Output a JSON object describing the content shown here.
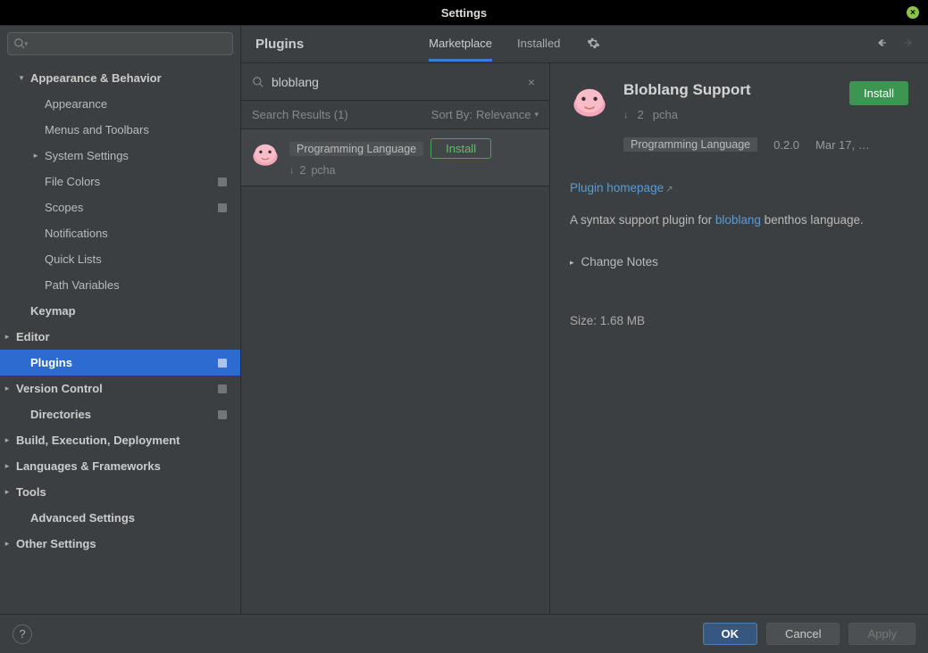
{
  "window": {
    "title": "Settings"
  },
  "sidebar": {
    "search_placeholder": "",
    "items": [
      {
        "label": "Appearance & Behavior"
      },
      {
        "label": "Appearance"
      },
      {
        "label": "Menus and Toolbars"
      },
      {
        "label": "System Settings"
      },
      {
        "label": "File Colors"
      },
      {
        "label": "Scopes"
      },
      {
        "label": "Notifications"
      },
      {
        "label": "Quick Lists"
      },
      {
        "label": "Path Variables"
      },
      {
        "label": "Keymap"
      },
      {
        "label": "Editor"
      },
      {
        "label": "Plugins"
      },
      {
        "label": "Version Control"
      },
      {
        "label": "Directories"
      },
      {
        "label": "Build, Execution, Deployment"
      },
      {
        "label": "Languages & Frameworks"
      },
      {
        "label": "Tools"
      },
      {
        "label": "Advanced Settings"
      },
      {
        "label": "Other Settings"
      }
    ]
  },
  "toolbar": {
    "title": "Plugins",
    "tabs": {
      "marketplace": "Marketplace",
      "installed": "Installed"
    }
  },
  "search": {
    "query": "bloblang",
    "results_label": "Search Results (1)",
    "sort_label": "Sort By:",
    "sort_value": "Relevance"
  },
  "result": {
    "category": "Programming Language",
    "install": "Install",
    "downloads": "2",
    "author": "pcha"
  },
  "detail": {
    "title": "Bloblang Support",
    "install": "Install",
    "downloads": "2",
    "author": "pcha",
    "category": "Programming Language",
    "version": "0.2.0",
    "date": "Mar 17, …",
    "homepage_label": "Plugin homepage",
    "desc_pre": "A syntax support plugin for ",
    "desc_link": "bloblang",
    "desc_post": " benthos language.",
    "change_notes": "Change Notes",
    "size": "Size: 1.68 MB"
  },
  "footer": {
    "ok": "OK",
    "cancel": "Cancel",
    "apply": "Apply"
  }
}
